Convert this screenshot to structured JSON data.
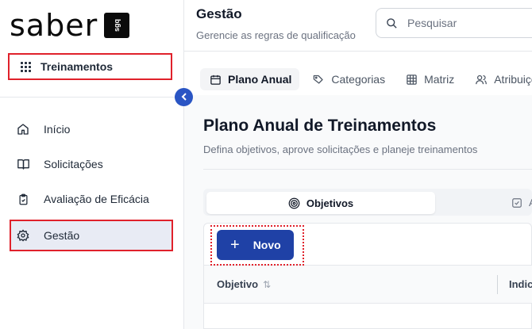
{
  "brand": {
    "logo_text": "saber",
    "badge_text": "sgq"
  },
  "sidebar": {
    "module_label": "Treinamentos",
    "items": [
      {
        "label": "Início",
        "icon": "home-icon"
      },
      {
        "label": "Solicitações",
        "icon": "book-icon"
      },
      {
        "label": "Avaliação de Eficácia",
        "icon": "clipboard-icon"
      },
      {
        "label": "Gestão",
        "icon": "gear-icon",
        "active": true
      }
    ]
  },
  "header": {
    "title": "Gestão",
    "subtitle": "Gerencie as regras de qualificação",
    "search_placeholder": "Pesquisar"
  },
  "tabs": [
    {
      "label": "Plano Anual",
      "icon": "calendar-icon",
      "active": true
    },
    {
      "label": "Categorias",
      "icon": "tag-icon"
    },
    {
      "label": "Matriz",
      "icon": "table-icon"
    },
    {
      "label": "Atribuiçõ",
      "icon": "users-icon"
    }
  ],
  "page": {
    "title": "Plano Anual de Treinamentos",
    "subtitle": "Defina objetivos, aprove solicitações e planeje treinamentos"
  },
  "subtabs": [
    {
      "label": "Objetivos",
      "icon": "target-icon",
      "active": true
    },
    {
      "label": "A",
      "icon": "checkbox-icon"
    }
  ],
  "toolbar": {
    "new_label": "Novo"
  },
  "table": {
    "columns": [
      "Objetivo",
      "Indic"
    ]
  },
  "colors": {
    "accent": "#1f41a6",
    "collapse": "#2a55c4",
    "highlight_border": "#e0212b",
    "active_bg": "#e8ebf4"
  }
}
